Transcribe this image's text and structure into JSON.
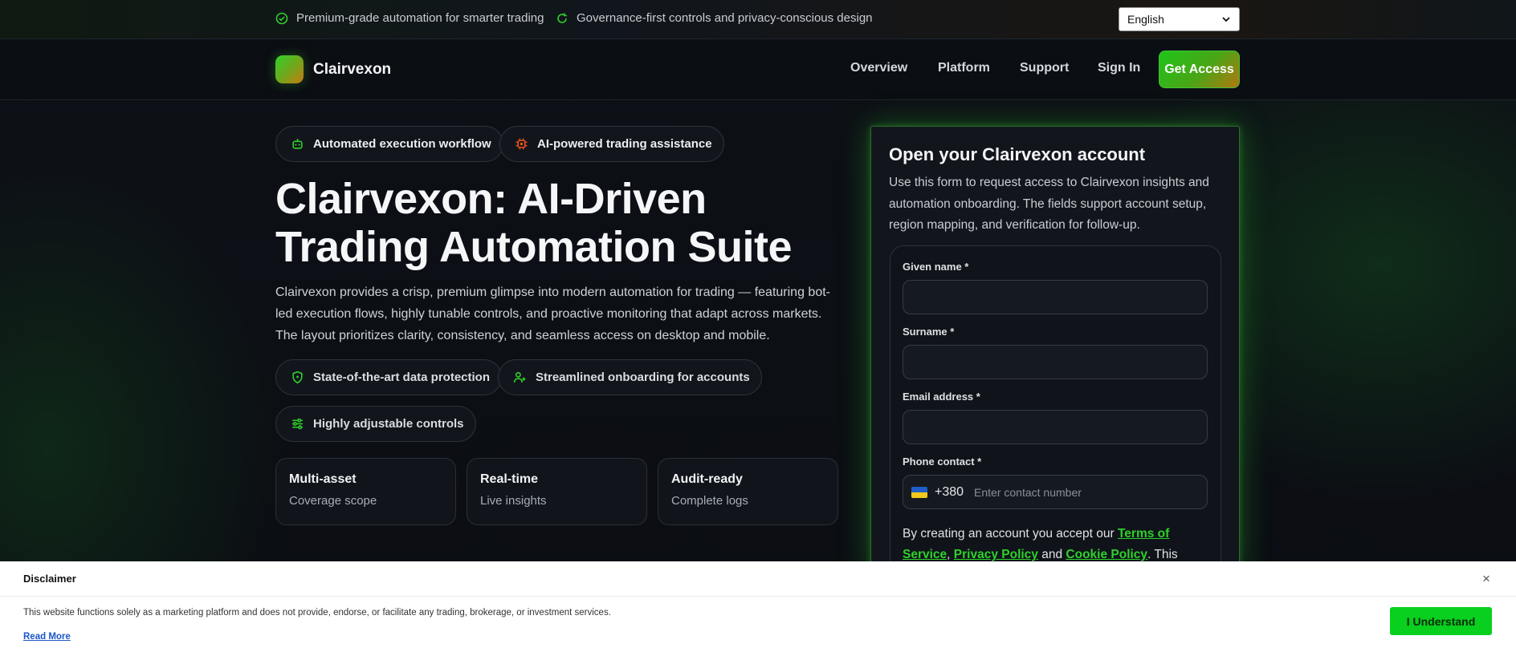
{
  "topbar": {
    "msg1": "Premium-grade automation for smarter trading",
    "msg2": "Governance-first controls and privacy-conscious design",
    "language": "English"
  },
  "nav": {
    "brand": "Clairvexon",
    "links": [
      "Overview",
      "Platform",
      "Support",
      "Sign In"
    ],
    "cta": "Get Access"
  },
  "hero": {
    "pills": [
      "Automated execution workflow",
      "AI-powered trading assistance"
    ],
    "title": "Clairvexon: AI-Driven Trading Automation Suite",
    "description": "Clairvexon provides a crisp, premium glimpse into modern automation for trading — featuring bot-led execution flows, highly tunable controls, and proactive monitoring that adapt across markets. The layout prioritizes clarity, consistency, and seamless access on desktop and mobile.",
    "features": [
      "State-of-the-art data protection",
      "Streamlined onboarding for accounts",
      "Highly adjustable controls"
    ],
    "stats": [
      {
        "title": "Multi-asset",
        "sub": "Coverage scope"
      },
      {
        "title": "Real-time",
        "sub": "Live insights"
      },
      {
        "title": "Audit-ready",
        "sub": "Complete logs"
      }
    ]
  },
  "form": {
    "title": "Open your Clairvexon account",
    "description": "Use this form to request access to Clairvexon insights and automation onboarding. The fields support account setup, region mapping, and verification for follow-up.",
    "given_name_label": "Given name *",
    "surname_label": "Surname *",
    "email_label": "Email address *",
    "phone_label": "Phone contact *",
    "phone_code": "+380",
    "phone_placeholder": "Enter contact number",
    "terms_prefix": "By creating an account you accept our ",
    "terms_link": "Terms of Service",
    "privacy_link": "Privacy Policy",
    "and_text": " and ",
    "cookie_link": "Cookie Policy",
    "terms_suffix": ". This"
  },
  "disclaimer": {
    "title": "Disclaimer",
    "close": "×",
    "text": "This website functions solely as a marketing platform and does not provide, endorse, or facilitate any trading, brokerage, or investment services.",
    "read_more": "Read More",
    "button": "I Understand"
  },
  "colors": {
    "accent": "#2ed12b",
    "bg": "#0c0f14",
    "button": "#09cf1e"
  }
}
